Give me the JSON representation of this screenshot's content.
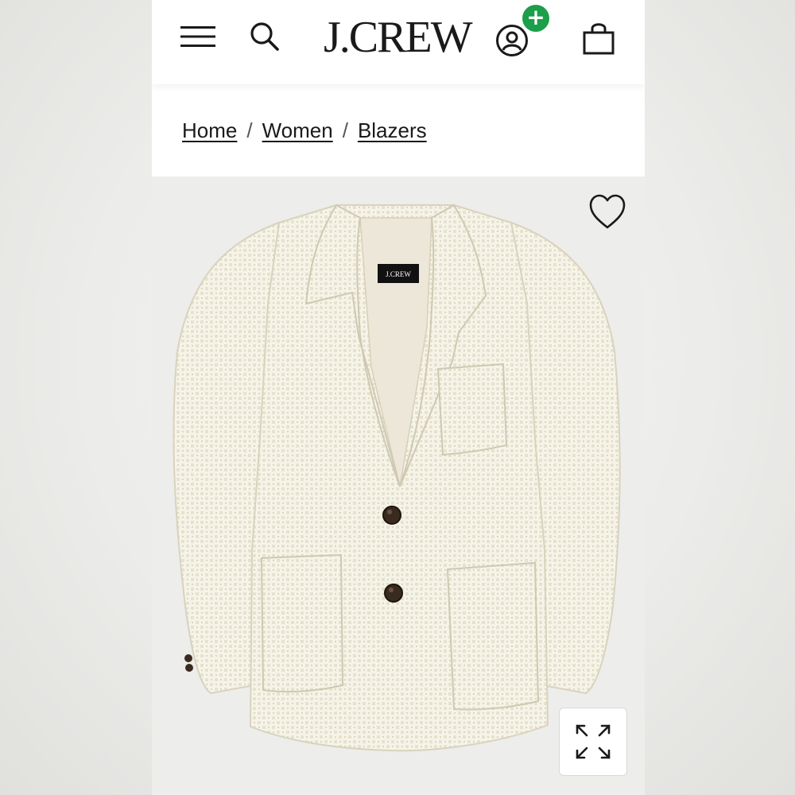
{
  "header": {
    "brand": "J.CREW",
    "icons": {
      "menu": "hamburger-menu-icon",
      "search": "search-icon",
      "account": "account-icon",
      "rewards_badge": "+",
      "bag": "shopping-bag-icon"
    },
    "accent_color": "#1c9e4a"
  },
  "breadcrumb": {
    "items": [
      "Home",
      "Women",
      "Blazers"
    ],
    "separator": "/"
  },
  "product": {
    "label_text": "J.CREW",
    "icons": {
      "wishlist": "heart-icon",
      "zoom": "expand-icon"
    }
  }
}
